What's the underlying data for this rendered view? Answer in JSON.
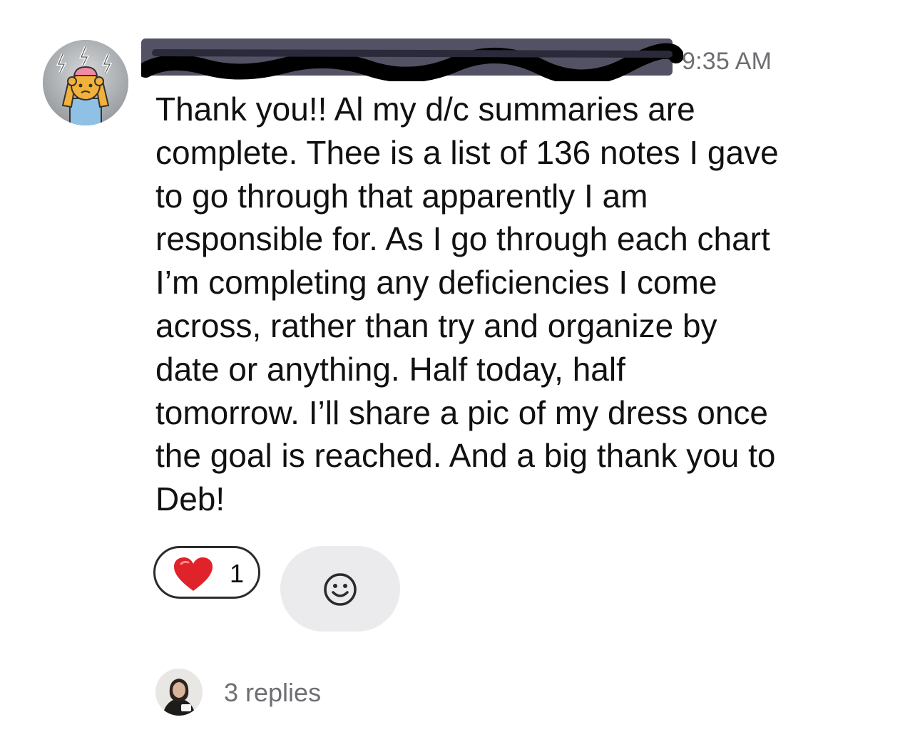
{
  "message": {
    "author_name": "[redacted]",
    "timestamp": "9:35 AM",
    "text": "Thank you!! Al my d/c summaries are\ncomplete. Thee is a list of 136 notes I gave\nto go through that apparently I am\nresponsible for. As I go through each chart\nI’m completing any deficiencies I come\nacross, rather than try and organize by\ndate or anything. Half today, half\ntomorrow. I’ll share a pic of my dress once\nthe goal is reached. And a big thank you to\nDeb!",
    "avatar_icon": "stressed-cartoon-avatar-icon"
  },
  "reactions": [
    {
      "emoji_icon": "red-heart-icon",
      "count": "1"
    }
  ],
  "add_reaction_icon": "smiley-face-icon",
  "thread": {
    "replies_label": "3 replies",
    "reply_avatar_icon": "user-photo-avatar-icon"
  },
  "colors": {
    "timestamp": "#6e6e73",
    "replies": "#6e6e73",
    "heart": "#e0222b",
    "add_reaction_bg": "#ebebed",
    "redaction": "#3a3a4e"
  }
}
